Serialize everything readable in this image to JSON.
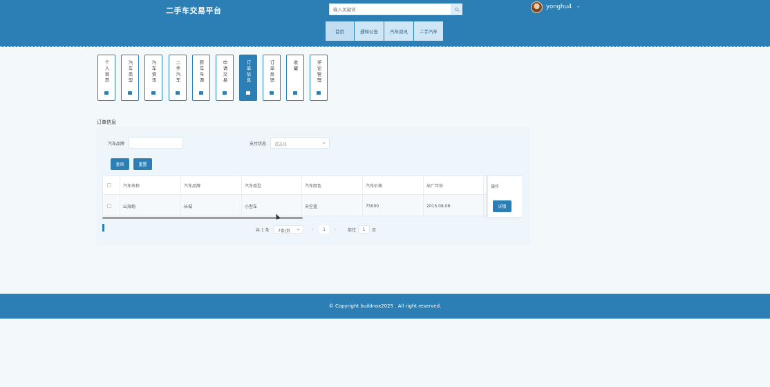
{
  "header": {
    "site_title": "二手车交易平台",
    "search_placeholder": "输入关键词",
    "username": "yonghu4",
    "user_menu_symbol": "-"
  },
  "nav": [
    "首页",
    "通知公告",
    "汽车资讯",
    "二手汽车"
  ],
  "side_tiles": [
    {
      "label": "个人首页",
      "active": false
    },
    {
      "label": "汽车类型",
      "active": false
    },
    {
      "label": "汽车资讯",
      "active": false
    },
    {
      "label": "二手汽车",
      "active": false
    },
    {
      "label": "新车车源",
      "active": false
    },
    {
      "label": "申请交易",
      "active": false
    },
    {
      "label": "订单信息",
      "active": true
    },
    {
      "label": "订单反馈",
      "active": false
    },
    {
      "label": "收藏",
      "active": false
    },
    {
      "label": "评论管理",
      "active": false
    }
  ],
  "section_title": "订单信息",
  "filters": {
    "car_name_label": "汽车品牌",
    "status_label": "支付状态",
    "status_placeholder": "请选择",
    "search_button": "查询",
    "reset_button": "重置"
  },
  "table": {
    "columns": [
      "汽车名称",
      "汽车品牌",
      "汽车类型",
      "汽车颜色",
      "汽车价格",
      "出厂年份"
    ],
    "truncated_col_letter": "t",
    "op_header": "操作",
    "rows": [
      {
        "cells": [
          "山海炮",
          "长城",
          "小型车",
          "天空蓝",
          "75000",
          "2015.08.06"
        ],
        "truncated": "y",
        "action": "详情"
      }
    ]
  },
  "pagination": {
    "total": "共 1 条",
    "page_size": "7条/页",
    "prev": "‹",
    "current": "1",
    "next": "›",
    "goto_label": "前往",
    "goto_value": "1",
    "page_suffix": "页"
  },
  "footer": {
    "copyright": "© Copyright buildnox2025 . All right reserved."
  },
  "colors": {
    "primary": "#2c7fb4",
    "background": "#f3f8fb"
  }
}
